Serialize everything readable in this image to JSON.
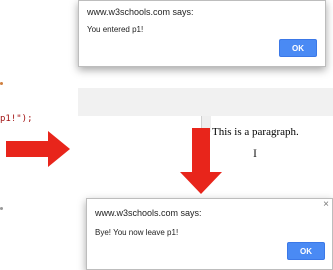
{
  "code": {
    "line1": "p1!\");"
  },
  "dialog_top": {
    "title": "www.w3schools.com says:",
    "message": "You entered p1!",
    "ok_label": "OK"
  },
  "dialog_bottom": {
    "title": "www.w3schools.com says:",
    "message": "Bye! You now leave p1!",
    "ok_label": "OK",
    "close_glyph": "×"
  },
  "page": {
    "paragraph": "This is a paragraph.",
    "cursor_glyph": "I"
  },
  "colors": {
    "arrow": "#e8251b",
    "ok_button": "#4a8af4"
  }
}
